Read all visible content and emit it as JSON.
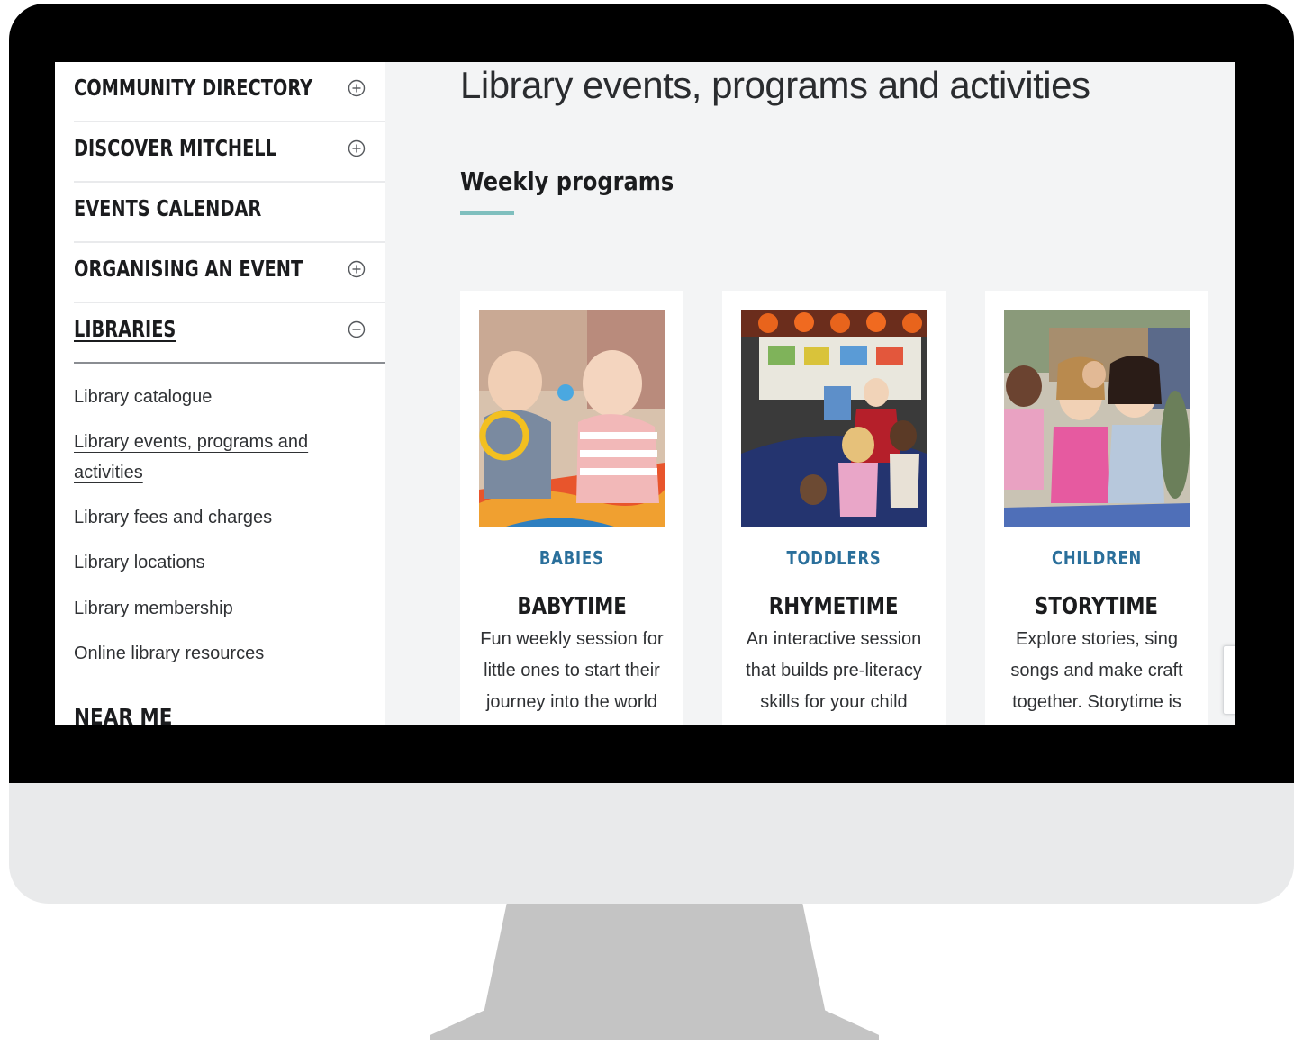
{
  "sidebar": {
    "nav_items": [
      {
        "label": "COMMUNITY DIRECTORY",
        "icon": "plus-circle-icon"
      },
      {
        "label": "DISCOVER MITCHELL",
        "icon": "plus-circle-icon"
      },
      {
        "label": "EVENTS CALENDAR",
        "icon": ""
      },
      {
        "label": "ORGANISING AN EVENT",
        "icon": "plus-circle-icon"
      },
      {
        "label": "LIBRARIES",
        "icon": "minus-circle-icon"
      }
    ],
    "sub_links": [
      "Library catalogue",
      "Library events, programs and",
      "activities",
      "Library fees and charges",
      "Library locations",
      "Library membership",
      "Online library resources"
    ],
    "near_me": "NEAR ME"
  },
  "main": {
    "page_title": "Library events, programs and activities",
    "section_heading": "Weekly programs",
    "cards": [
      {
        "category": "BABIES",
        "title": "BABYTIME",
        "description_lines": [
          "Fun weekly session for",
          "little ones to start their",
          "journey into the world"
        ]
      },
      {
        "category": "TODDLERS",
        "title": "RHYMETIME",
        "description_lines": [
          "An interactive session",
          "that builds pre-literacy",
          "skills for your child"
        ]
      },
      {
        "category": "CHILDREN",
        "title": "STORYTIME",
        "description_lines": [
          "Explore stories, sing",
          "songs and make craft",
          "together. Storytime is"
        ]
      }
    ]
  },
  "colors": {
    "accent_rule": "#7fbfbe",
    "category_blue": "#2a6f9b",
    "bezel": "#000000",
    "chin": "#e9eaeb",
    "stand": "#c4c4c4"
  }
}
